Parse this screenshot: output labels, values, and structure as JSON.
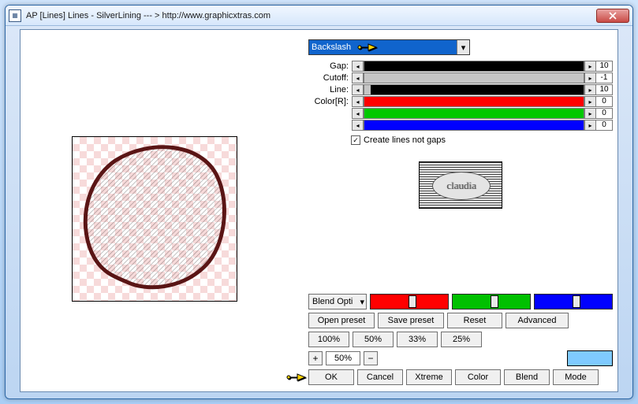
{
  "window": {
    "title": "AP [Lines]  Lines - SilverLining    --- >  http://www.graphicxtras.com"
  },
  "combo": {
    "selected": "Backslash"
  },
  "sliders": {
    "gap": {
      "label": "Gap:",
      "value": "10",
      "fill_pct": 2,
      "fill_color": "#000000",
      "rest_color": "#000000"
    },
    "cutoff": {
      "label": "Cutoff:",
      "value": "-1",
      "fill_pct": 2,
      "fill_color": "#c5c5c5",
      "rest_color": "#c5c5c5"
    },
    "line": {
      "label": "Line:",
      "value": "10",
      "fill_pct": 5,
      "fill_color": "#000000",
      "rest_color": "#000000"
    },
    "r": {
      "label": "Color[R]:",
      "value": "0",
      "fill_pct": 100,
      "fill_color": "#ff0000",
      "rest_color": "#ff0000"
    },
    "g": {
      "label": "",
      "value": "0",
      "fill_pct": 100,
      "fill_color": "#00d000",
      "rest_color": "#00d000"
    },
    "b": {
      "label": "",
      "value": "0",
      "fill_pct": 100,
      "fill_color": "#0000ff",
      "rest_color": "#0000ff"
    }
  },
  "checkbox": {
    "label": "Create lines not gaps",
    "checked": true
  },
  "logo": {
    "text": "claudia"
  },
  "blend": {
    "combo": "Blend Opti",
    "sliders": [
      {
        "color": "#ff0000"
      },
      {
        "color": "#00c000"
      },
      {
        "color": "#0000ff"
      }
    ]
  },
  "buttons": {
    "row1": [
      "Open preset",
      "Save preset",
      "Reset",
      "Advanced"
    ],
    "pcts": [
      "100%",
      "50%",
      "33%",
      "25%"
    ],
    "zoom": "50%",
    "actions": [
      "OK",
      "Cancel",
      "Xtreme",
      "Color",
      "Blend",
      "Mode"
    ]
  }
}
